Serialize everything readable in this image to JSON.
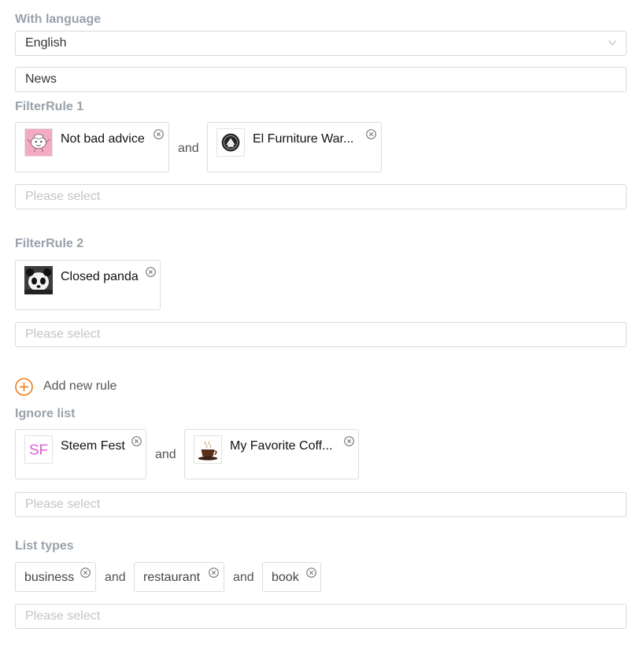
{
  "language": {
    "label": "With language",
    "selected": "English"
  },
  "news_field": {
    "value": "News"
  },
  "rules": [
    {
      "label": "FilterRule 1",
      "items": [
        {
          "name": "Not bad advice",
          "icon": "not-bad-advice-avatar"
        },
        {
          "name": "El Furniture War...",
          "icon": "el-furniture-avatar"
        }
      ],
      "connector": "and",
      "placeholder": "Please select"
    },
    {
      "label": "FilterRule 2",
      "items": [
        {
          "name": "Closed panda",
          "icon": "panda-avatar"
        }
      ],
      "placeholder": "Please select"
    }
  ],
  "add_rule": {
    "label": "Add new rule",
    "accent": "#f07c1b"
  },
  "ignore_list": {
    "label": "Ignore list",
    "items": [
      {
        "name": "Steem Fest",
        "icon_text": "SF",
        "icon_color": "#d75ed8"
      },
      {
        "name": "My Favorite Coff...",
        "icon": "coffee-cup-avatar"
      }
    ],
    "connector": "and",
    "placeholder": "Please select"
  },
  "list_types": {
    "label": "List types",
    "tags": [
      "business",
      "restaurant",
      "book"
    ],
    "connector": "and",
    "placeholder": "Please select"
  }
}
